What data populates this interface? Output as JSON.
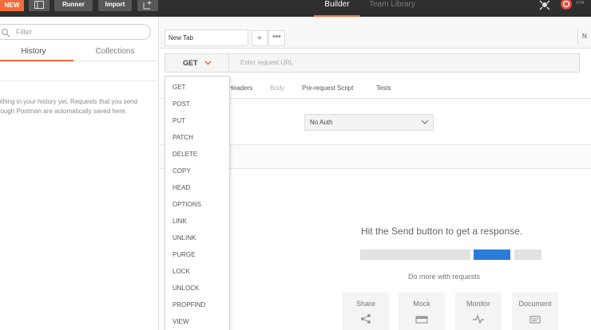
{
  "topbar": {
    "new_label": "NEW",
    "runner_label": "Runner",
    "import_label": "Import",
    "tabs": [
      {
        "label": "Builder",
        "active": true
      },
      {
        "label": "Team Library",
        "active": false
      }
    ],
    "sync_label": "SYN",
    "colors": {
      "bar": "#2f2f2f",
      "accent": "#f26b3a",
      "sync": "#e8473c"
    }
  },
  "sidebar": {
    "filter_placeholder": "Filter",
    "tabs": [
      {
        "label": "History",
        "active": true
      },
      {
        "label": "Collections",
        "active": false
      }
    ],
    "empty_message": "Nothing in your history yet. Requests that you send through Postman are automatically saved here."
  },
  "request": {
    "tab_label": "New Tab",
    "add_tab": "+",
    "more_tab": "•••",
    "env_label": "N",
    "method": "GET",
    "url_placeholder": "Enter request URL",
    "subtabs": [
      "Headers",
      "Body",
      "Pre-request Script",
      "Tests"
    ],
    "auth_value": "No Auth"
  },
  "method_dropdown": {
    "items": [
      "GET",
      "POST",
      "PUT",
      "PATCH",
      "DELETE",
      "COPY",
      "HEAD",
      "OPTIONS",
      "LINK",
      "UNLINK",
      "PURGE",
      "LOCK",
      "UNLOCK",
      "PROPFIND",
      "VIEW"
    ]
  },
  "response": {
    "hint": "Hit the Send button to get a response.",
    "more": "Do more with requests",
    "cards": [
      "Share",
      "Mock",
      "Monitor",
      "Document"
    ],
    "colors": {
      "primary": "#2d7bd8",
      "placeholder": "#e2e2e2"
    }
  }
}
